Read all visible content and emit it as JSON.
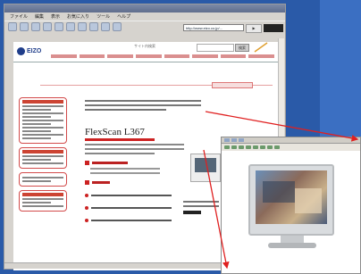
{
  "browser": {
    "menu_items": [
      "ファイル",
      "編集",
      "表示",
      "お気に入り",
      "ツール",
      "ヘルプ"
    ],
    "address": "http://www.eizo.co.jp/..."
  },
  "site": {
    "logo_text": "EIZO",
    "search_label": "サイト内検索",
    "search_button": "検索"
  },
  "product": {
    "title": "FlexScan L367"
  },
  "colors": {
    "accent": "#cc2222",
    "desktop": "#2a5aa8"
  }
}
